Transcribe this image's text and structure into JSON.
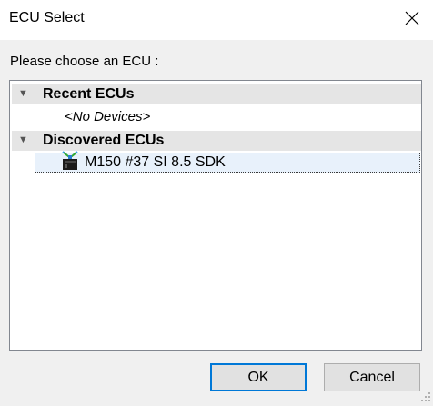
{
  "window": {
    "title": "ECU Select",
    "close_icon": "close-icon"
  },
  "prompt": "Please choose an ECU :",
  "tree": {
    "groups": [
      {
        "label": "Recent ECUs",
        "expanded": true,
        "items": [],
        "empty_text": "<No Devices>"
      },
      {
        "label": "Discovered ECUs",
        "expanded": true,
        "items": [
          {
            "label": "M150 #37 SI 8.5 SDK",
            "icon": "ecu-device-icon",
            "selected": true
          }
        ]
      }
    ]
  },
  "buttons": {
    "ok": "OK",
    "cancel": "Cancel"
  },
  "colors": {
    "accent": "#0078d7",
    "selection_bg": "#e8f1fb",
    "group_header_bg": "#e5e5e5"
  }
}
